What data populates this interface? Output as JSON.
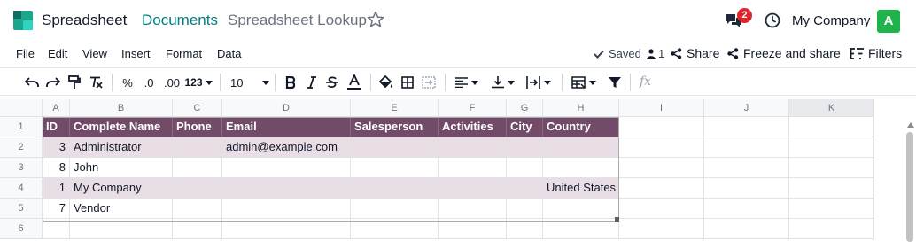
{
  "nav": {
    "app_name": "Spreadsheet",
    "breadcrumb_parent": "Documents",
    "breadcrumb_current": "Spreadsheet Lookup",
    "chat_count": "2",
    "company": "My Company",
    "avatar_letter": "A",
    "brand_color": "#017e84",
    "badge_color": "#e3232b",
    "avatar_color": "#1fb34b"
  },
  "menu": {
    "file": "File",
    "edit": "Edit",
    "view": "View",
    "insert": "Insert",
    "format": "Format",
    "data": "Data",
    "saved": "Saved",
    "users_count": "1",
    "share": "Share",
    "freeze_share": "Freeze and share",
    "filters": "Filters"
  },
  "toolbar": {
    "percent": "%",
    "dec_decrease": ".0",
    "dec_increase": ".00",
    "number_format": "123",
    "font_size": "10",
    "formula_placeholder": "fx",
    "icons": [
      "undo-icon",
      "redo-icon",
      "paint-format-icon",
      "clear-format-icon",
      "bold-icon",
      "italic-icon",
      "strikethrough-icon",
      "text-color-icon",
      "fill-color-icon",
      "borders-icon",
      "merge-cells-icon",
      "align-horizontal-icon",
      "align-vertical-icon",
      "wrap-text-icon",
      "table-style-icon",
      "filter-icon"
    ]
  },
  "sheet": {
    "columns": [
      "A",
      "B",
      "C",
      "D",
      "E",
      "F",
      "G",
      "H",
      "I",
      "J",
      "K"
    ],
    "rows": [
      "1",
      "2",
      "3",
      "4",
      "5",
      "6"
    ],
    "table_header_color": "#714b67",
    "table_band_color": "#e9dde6",
    "header": [
      "ID",
      "Complete Name",
      "Phone",
      "Email",
      "Salesperson",
      "Activities",
      "City",
      "Country"
    ],
    "data": [
      [
        "3",
        "Administrator",
        "",
        "admin@example.com",
        "",
        "",
        "",
        ""
      ],
      [
        "8",
        "John",
        "",
        "",
        "",
        "",
        "",
        ""
      ],
      [
        "1",
        "My Company",
        "",
        "",
        "",
        "",
        "",
        "United States"
      ],
      [
        "7",
        "Vendor",
        "",
        "",
        "",
        "",
        "",
        ""
      ]
    ]
  }
}
